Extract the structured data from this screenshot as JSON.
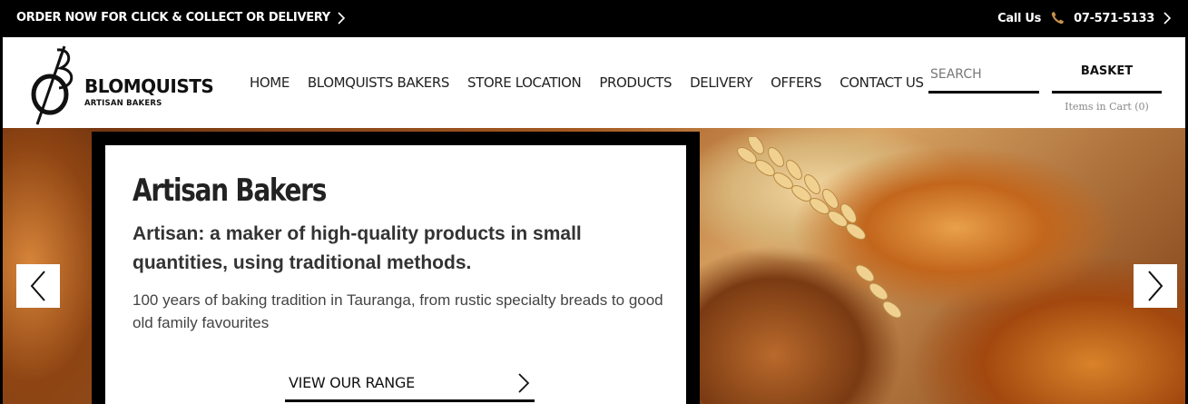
{
  "topbar": {
    "order_label": "ORDER NOW FOR CLICK & COLLECT OR DELIVERY",
    "call_label": "Call Us",
    "phone": "07-571-5133"
  },
  "logo": {
    "name": "BLOMQUISTS",
    "tagline": "ARTISAN BAKERS"
  },
  "nav": {
    "items": [
      {
        "label": "HOME"
      },
      {
        "label": "BLOMQUISTS BAKERS"
      },
      {
        "label": "STORE LOCATION"
      },
      {
        "label": "PRODUCTS"
      },
      {
        "label": "DELIVERY"
      },
      {
        "label": "OFFERS"
      },
      {
        "label": "CONTACT US"
      }
    ]
  },
  "search": {
    "placeholder": "SEARCH"
  },
  "basket": {
    "label": "BASKET",
    "cart_text": "Items in Cart (0)"
  },
  "hero": {
    "title": "Artisan Bakers",
    "subtitle": "Artisan: a maker of high-quality products in small quantities, using traditional methods.",
    "body": "100 years of baking tradition in Tauranga, from rustic specialty breads to good old family favourites",
    "cta": "VIEW OUR RANGE"
  },
  "icons": {
    "phone": "phone-icon",
    "chevron": "chevron-right-icon",
    "prev": "chevron-left-icon",
    "next": "chevron-right-icon"
  },
  "colors": {
    "topbar_bg": "#000000",
    "phone_icon": "#c8914a",
    "text_dark": "#222222"
  }
}
